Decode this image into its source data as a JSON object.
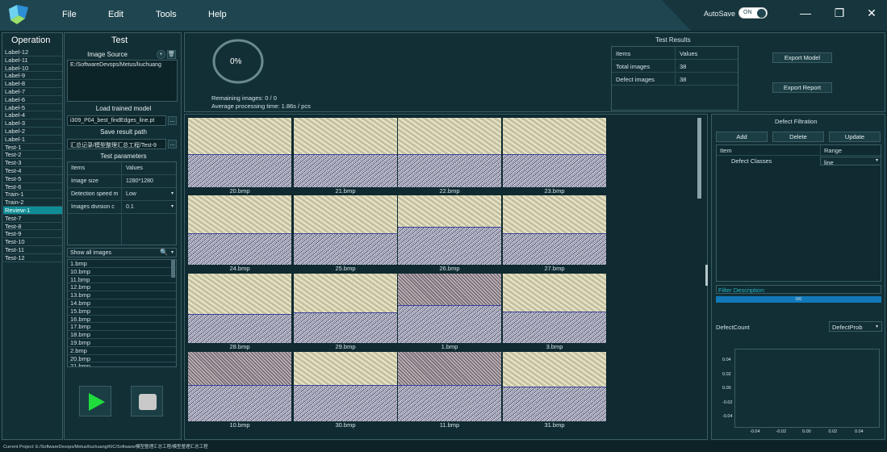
{
  "menu": {
    "file": "File",
    "edit": "Edit",
    "tools": "Tools",
    "help": "Help"
  },
  "autosave": {
    "label": "AutoSave",
    "state": "ON"
  },
  "window_controls": {
    "minimize": "—",
    "restore": "❐",
    "close": "✕"
  },
  "operation": {
    "title": "Operation",
    "items": [
      "Label-12",
      "Label-11",
      "Label-10",
      "Label-9",
      "Label-8",
      "Label-7",
      "Label-6",
      "Label-5",
      "Label-4",
      "Label-3",
      "Label-2",
      "Label-1",
      "Test-1",
      "Test-2",
      "Test-3",
      "Test-4",
      "Test-5",
      "Test-6",
      "Train-1",
      "Train-2",
      "Review-1",
      "Test-7",
      "Test-8",
      "Test-9",
      "Test-10",
      "Test-11",
      "Test-12"
    ],
    "selected": "Review-1"
  },
  "test": {
    "title": "Test",
    "image_source_label": "Image Source",
    "image_source_value": "E:/SoftwareDevops/Metus/liuchuang",
    "load_model_label": "Load trained model",
    "load_model_value": "i309_P04_best_findEdges_line.pt",
    "save_path_label": "Save result path",
    "save_path_value": "汇总记录/模型整理汇总工程/Test-9",
    "browse": "...",
    "params_label": "Test parameters",
    "params_header": [
      "Items",
      "Values"
    ],
    "params": [
      {
        "item": "Image size",
        "value": "1280*1280"
      },
      {
        "item": "Detection speed m",
        "value": "Low"
      },
      {
        "item": "Images division c",
        "value": "0.1"
      }
    ],
    "show_all_label": "Show all images",
    "images": [
      "1.bmp",
      "10.bmp",
      "11.bmp",
      "12.bmp",
      "13.bmp",
      "14.bmp",
      "15.bmp",
      "16.bmp",
      "17.bmp",
      "18.bmp",
      "19.bmp",
      "2.bmp",
      "20.bmp",
      "21.bmp"
    ]
  },
  "progress": {
    "percent_label": "0%",
    "remaining": "Remaining images: 0 / 0",
    "avg_time": "Average processing time: 1.86s / pcs"
  },
  "results": {
    "title": "Test Results",
    "header": [
      "Items",
      "Values"
    ],
    "rows": [
      {
        "item": "Total images",
        "value": "38"
      },
      {
        "item": "Defect images",
        "value": "38"
      }
    ],
    "export_model": "Export Model",
    "export_report": "Export Report"
  },
  "gallery": [
    {
      "name": "20.bmp",
      "type": "clean",
      "split": 0.52
    },
    {
      "name": "21.bmp",
      "type": "clean",
      "split": 0.52
    },
    {
      "name": "22.bmp",
      "type": "clean",
      "split": 0.52
    },
    {
      "name": "23.bmp",
      "type": "clean",
      "split": 0.52
    },
    {
      "name": "24.bmp",
      "type": "clean",
      "split": 0.55
    },
    {
      "name": "25.bmp",
      "type": "clean",
      "split": 0.55
    },
    {
      "name": "26.bmp",
      "type": "clean",
      "split": 0.45
    },
    {
      "name": "27.bmp",
      "type": "clean",
      "split": 0.55
    },
    {
      "name": "28.bmp",
      "type": "clean",
      "split": 0.58
    },
    {
      "name": "29.bmp",
      "type": "clean",
      "split": 0.56
    },
    {
      "name": "1.bmp",
      "type": "noisy",
      "split": 0.45
    },
    {
      "name": "3.bmp",
      "type": "clean",
      "split": 0.55
    },
    {
      "name": "10.bmp",
      "type": "noisy",
      "split": 0.48
    },
    {
      "name": "30.bmp",
      "type": "clean",
      "split": 0.48
    },
    {
      "name": "11.bmp",
      "type": "noisy",
      "split": 0.48
    },
    {
      "name": "31.bmp",
      "type": "clean",
      "split": 0.5
    }
  ],
  "defect_filtration": {
    "title": "Defect Filtration",
    "add": "Add",
    "delete": "Delete",
    "update": "Update",
    "header": [
      "Item",
      "Range"
    ],
    "rows": [
      {
        "item": "Defect Classes",
        "value": "line"
      }
    ],
    "filter_description": "Filter Description:",
    "bar_text": "0/0",
    "defect_count_label": "DefectCount",
    "defect_prob_select": "DefectProb",
    "chart_y_ticks": [
      "0.04",
      "0.02",
      "0.00",
      "-0.02",
      "-0.04"
    ],
    "chart_x_ticks": [
      "-0.04",
      "-0.02",
      "0.00",
      "0.02",
      "0.04"
    ]
  },
  "status": {
    "text": "Current Project: E:/SoftwareDevops/Metus/liuchuang/KIC/Software/模型整理汇总工程/模型整理汇总工程"
  },
  "colors": {
    "accent": "#0f8d96",
    "play": "#1fdc3c"
  }
}
